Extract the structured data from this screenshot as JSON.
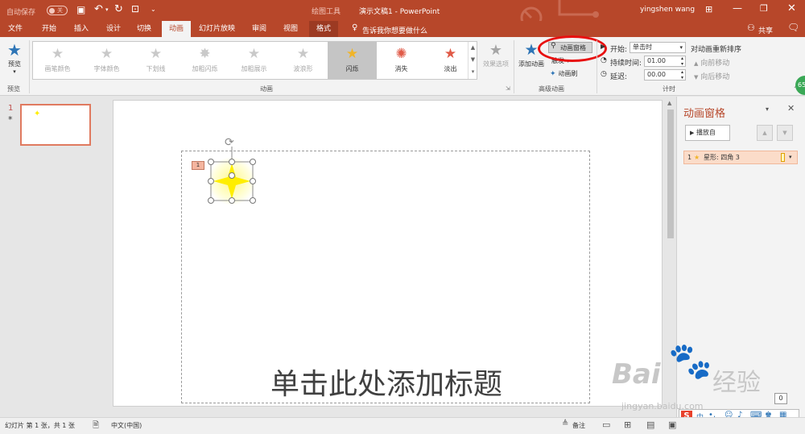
{
  "titlebar": {
    "autosave_label": "自动保存",
    "autosave_state": "关",
    "context_tool": "绘图工具",
    "doc_title": "演示文稿1 - PowerPoint",
    "user": "yingshen wang"
  },
  "tabs": [
    "文件",
    "开始",
    "插入",
    "设计",
    "切换",
    "动画",
    "幻灯片放映",
    "审阅",
    "视图",
    "格式"
  ],
  "active_tab": "动画",
  "tell_me": "告诉我你想要做什么",
  "share": "共享",
  "ribbon": {
    "preview_label": "预览",
    "preview_group": "预览",
    "gallery": [
      {
        "label": "画笔颜色",
        "glyph": "★",
        "state": "disabled"
      },
      {
        "label": "字体颜色",
        "glyph": "★",
        "state": "disabled"
      },
      {
        "label": "下划线",
        "glyph": "★",
        "state": "disabled"
      },
      {
        "label": "加粗闪烁",
        "glyph": "✸",
        "state": "disabled"
      },
      {
        "label": "加粗展示",
        "glyph": "★",
        "state": "disabled"
      },
      {
        "label": "波浪形",
        "glyph": "★",
        "state": "disabled"
      },
      {
        "label": "闪烁",
        "glyph": "★",
        "state": "selected",
        "color": "#f0b429"
      },
      {
        "label": "消失",
        "glyph": "✺",
        "state": "normal",
        "color": "#e05a47"
      },
      {
        "label": "淡出",
        "glyph": "★",
        "state": "normal",
        "color": "#e05a47"
      }
    ],
    "effect_options": "效果选项",
    "animation_group": "动画",
    "add_animation": "添加动画",
    "animation_pane": "动画窗格",
    "trigger": "触发",
    "animation_painter": "动画刷",
    "advanced_group": "高级动画",
    "start_label": "开始:",
    "start_value": "单击时",
    "duration_label": "持续时间:",
    "duration_value": "01.00",
    "delay_label": "延迟:",
    "delay_value": "00.00",
    "reorder_title": "对动画重新排序",
    "move_earlier": "向前移动",
    "move_later": "向后移动",
    "timing_group": "计时",
    "badge": "65"
  },
  "thumbnail": {
    "number": "1",
    "marker": "*"
  },
  "slide": {
    "title_placeholder": "单击此处添加标题",
    "anim_tag": "1"
  },
  "pane": {
    "title": "动画窗格",
    "play_button": "播放自",
    "item_number": "1",
    "item_label": "星形: 四角 3"
  },
  "statusbar": {
    "slide_info": "幻灯片 第 1 张，共 1 张",
    "language": "中文(中国)",
    "notes": "备注"
  },
  "watermark": {
    "brand": "Bai",
    "brand_cn": "经验",
    "url": "jingyan.baidu.com"
  },
  "ime": {
    "glyph": "中"
  },
  "colors": {
    "accent": "#b7472a",
    "highlight_circle": "#e81010",
    "star": "#ffee00"
  }
}
